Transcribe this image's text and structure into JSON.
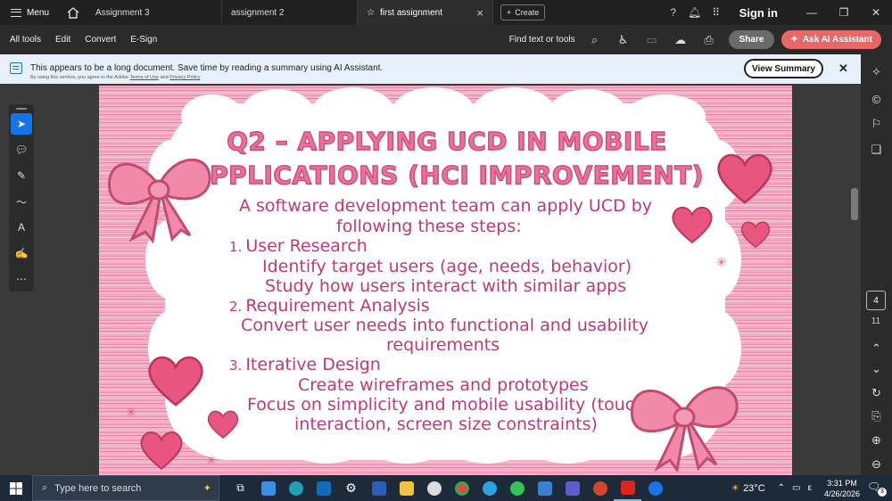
{
  "titlebar": {
    "menu_label": "Menu",
    "tabs": [
      {
        "label": "Assignment 3"
      },
      {
        "label": "assignment 2"
      },
      {
        "label": "first assignment"
      }
    ],
    "create_label": "Create",
    "signin_label": "Sign in"
  },
  "toolbar": {
    "items": [
      "All tools",
      "Edit",
      "Convert",
      "E-Sign"
    ],
    "find_label": "Find text or tools",
    "share_label": "Share",
    "ai_label": "Ask AI Assistant"
  },
  "banner": {
    "message": "This appears to be a long document. Save time by reading a summary using AI Assistant.",
    "sub_prefix": "By using this service, you agree to the Adobe",
    "terms_link": "Terms of Use",
    "sub_and": "and",
    "privacy_link": "Privacy Policy",
    "view_summary_label": "View Summary"
  },
  "navigator": {
    "current_page": "4",
    "total_pages": "11"
  },
  "slide": {
    "title_line1": "Q2 – APPLYING UCD IN MOBILE",
    "title_line2": "APPLICATIONS (HCI IMPROVEMENT)",
    "intro_line1": "A software development team can apply UCD by",
    "intro_line2": "following these steps:",
    "step1_num": "1.",
    "step1_title": "User Research",
    "step1_a": "Identify target users (age, needs, behavior)",
    "step1_b": "Study how users interact with similar apps",
    "step2_num": "2.",
    "step2_title": "Requirement Analysis",
    "step2_a": "Convert user needs into functional and usability",
    "step2_b": "requirements",
    "step3_num": "3.",
    "step3_title": "Iterative Design",
    "step3_a": "Create wireframes and prototypes",
    "step3_b": "Focus on simplicity and mobile usability (touch",
    "step3_c": "interaction, screen size constraints)"
  },
  "taskbar": {
    "search_placeholder": "Type here to search",
    "temperature": "23°C",
    "time": "3:31 PM",
    "date": "4/26/2026",
    "notification_count": "3",
    "language_indicator": "ε"
  },
  "colors": {
    "accent_blue": "#1473e6",
    "ai_button": "#e86868",
    "title_pink": "#ef6f9a",
    "body_text": "#c03a72",
    "bow_pink": "#f08aa8"
  }
}
